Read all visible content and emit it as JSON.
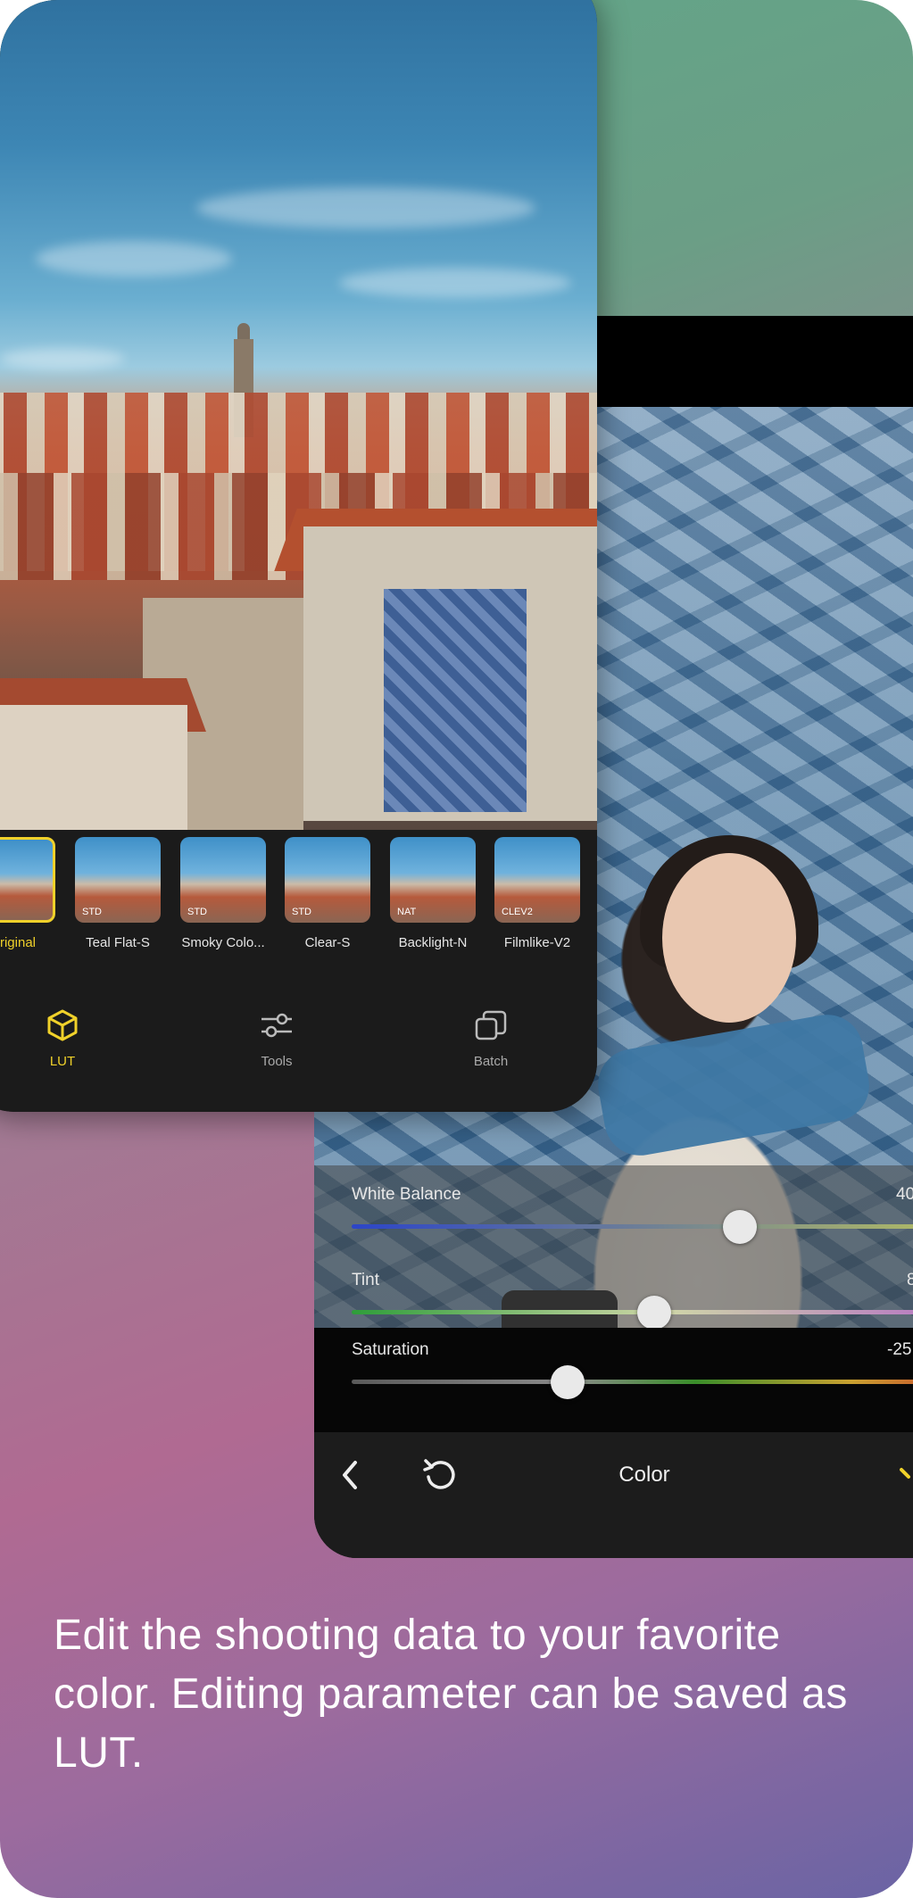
{
  "editor": {
    "sliders": [
      {
        "label": "White Balance",
        "value": "40",
        "level": 0.46
      },
      {
        "label": "Tint",
        "value": "8",
        "level": 0.36
      },
      {
        "label": "Saturation",
        "value": "-25",
        "level": 0.25
      }
    ],
    "bottom_title": "Color"
  },
  "luts": [
    {
      "label": "riginal",
      "badge": "",
      "selected": true
    },
    {
      "label": "Teal Flat-S",
      "badge": "STD",
      "selected": false
    },
    {
      "label": "Smoky Colo...",
      "badge": "STD",
      "selected": false
    },
    {
      "label": "Clear-S",
      "badge": "STD",
      "selected": false
    },
    {
      "label": "Backlight-N",
      "badge": "NAT",
      "selected": false
    },
    {
      "label": "Filmlike-V2",
      "badge": "CLEV2",
      "selected": false
    }
  ],
  "tabs": [
    {
      "label": "LUT",
      "icon": "cube-icon",
      "active": true
    },
    {
      "label": "Tools",
      "icon": "sliders-icon",
      "active": false
    },
    {
      "label": "Batch",
      "icon": "layers-icon",
      "active": false
    }
  ],
  "caption": "Edit the shooting data to your favorite color. Editing parameter can be saved as LUT.",
  "colors": {
    "accent": "#f0d12a",
    "bg_top": "#5fa889",
    "bg_bottom": "#6a64a4"
  }
}
